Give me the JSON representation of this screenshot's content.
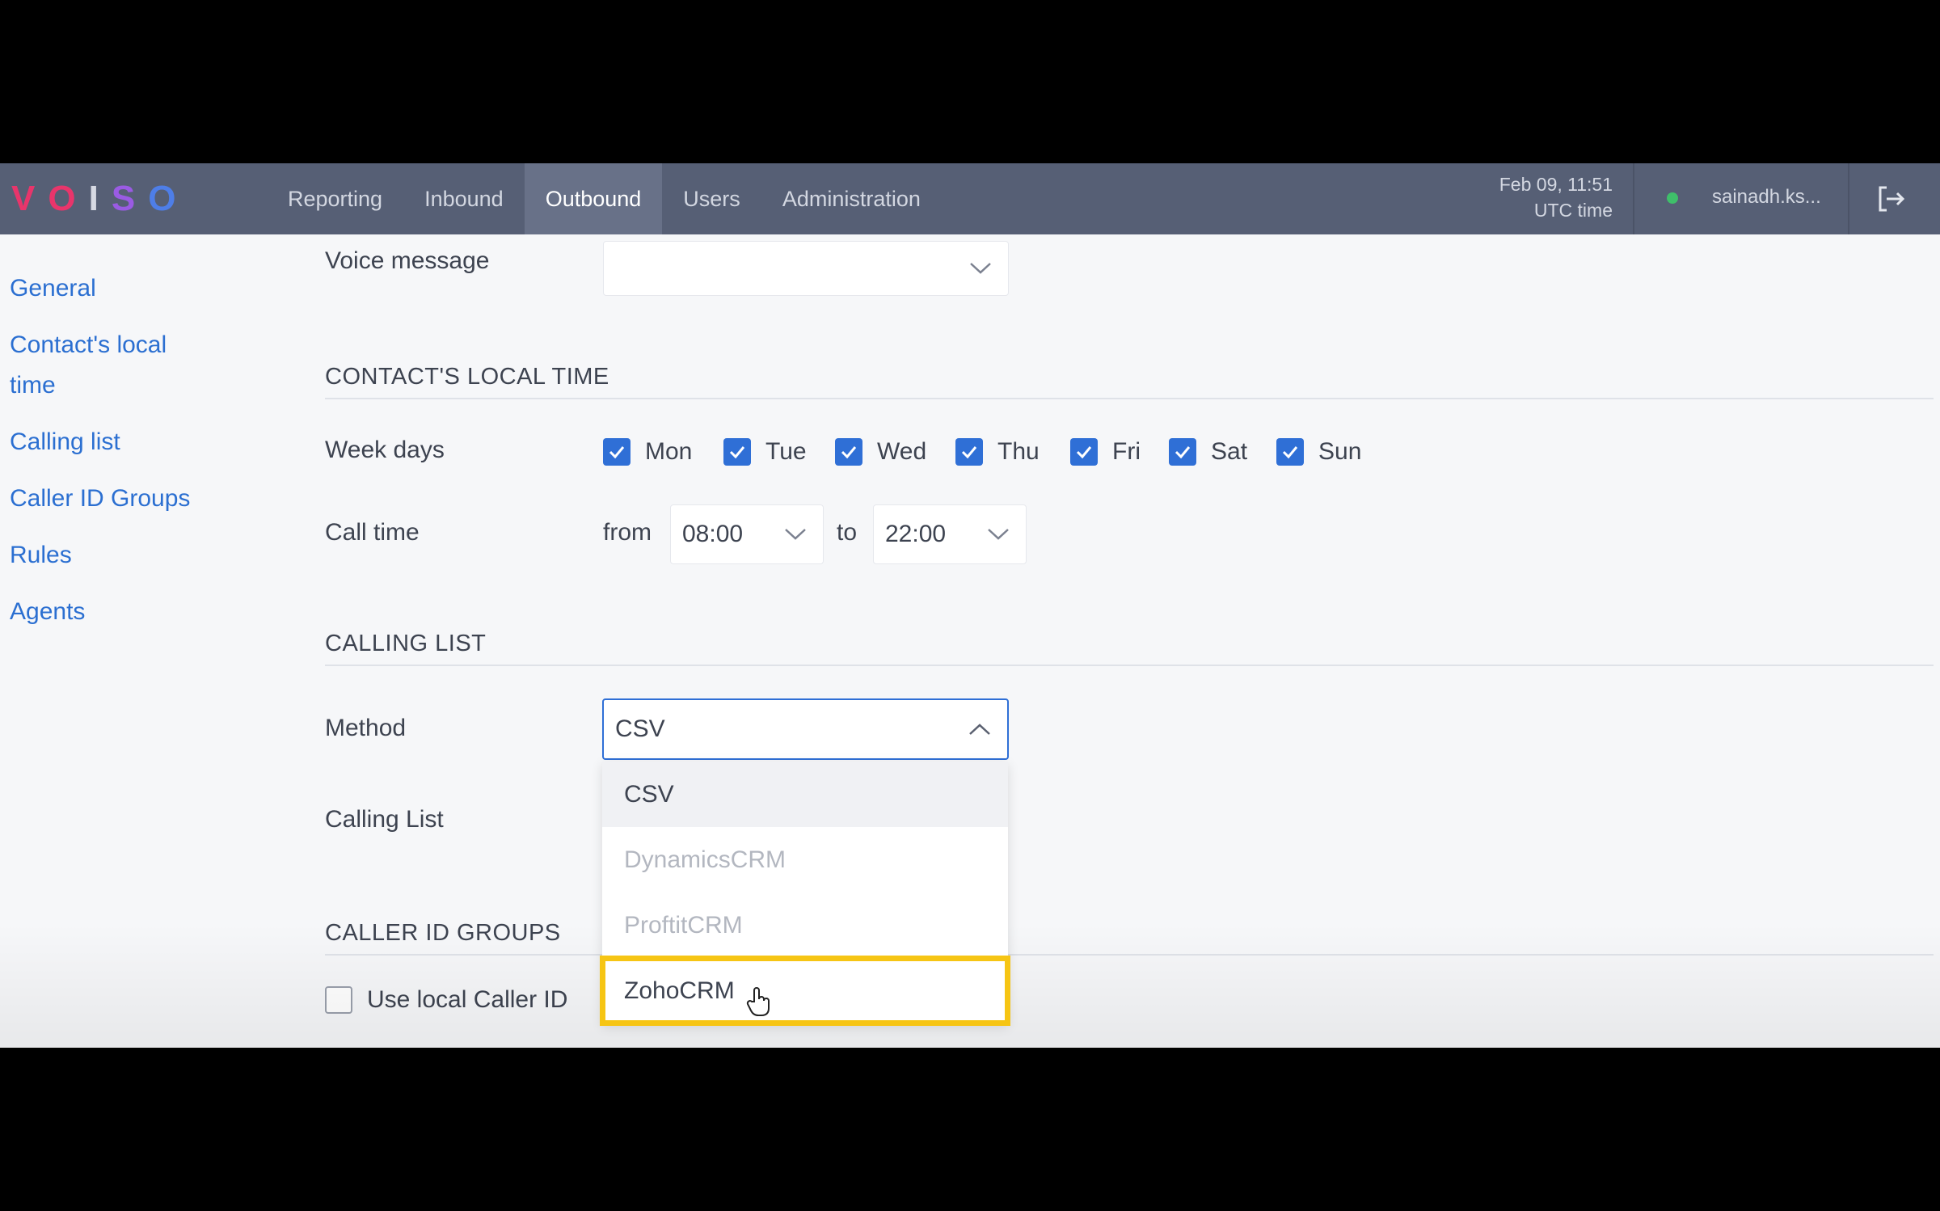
{
  "app": {
    "logo_letters": [
      "V",
      "O",
      "I",
      "S",
      "O"
    ],
    "logo_colors": [
      "#e8356b",
      "#e8356b",
      "#d6d9e3",
      "#9a5be3",
      "#4e7ee8"
    ]
  },
  "nav": {
    "items": [
      "Reporting",
      "Inbound",
      "Outbound",
      "Users",
      "Administration"
    ],
    "active": "Outbound",
    "date": "Feb 09, 11:51",
    "timezone": "UTC time",
    "username": "sainadh.ks...",
    "status_color": "#3fbf6a"
  },
  "sidebar": {
    "items": [
      "General",
      "Contact's local time",
      "Calling list",
      "Caller ID Groups",
      "Rules",
      "Agents"
    ]
  },
  "voice_message": {
    "label": "Voice message",
    "value": ""
  },
  "local_time": {
    "section": "CONTACT'S LOCAL TIME",
    "week_days_label": "Week days",
    "days": [
      "Mon",
      "Tue",
      "Wed",
      "Thu",
      "Fri",
      "Sat",
      "Sun"
    ],
    "call_time_label": "Call time",
    "from_label": "from",
    "from_value": "08:00",
    "to_label": "to",
    "to_value": "22:00"
  },
  "calling_list": {
    "section": "CALLING LIST",
    "method_label": "Method",
    "method_value": "CSV",
    "calling_list_label": "Calling List",
    "options": [
      "CSV",
      "DynamicsCRM",
      "ProftitCRM",
      "ZohoCRM"
    ],
    "highlight_color": "#f6c514"
  },
  "caller_id": {
    "section": "CALLER ID GROUPS",
    "use_local_label": "Use local Caller ID"
  }
}
